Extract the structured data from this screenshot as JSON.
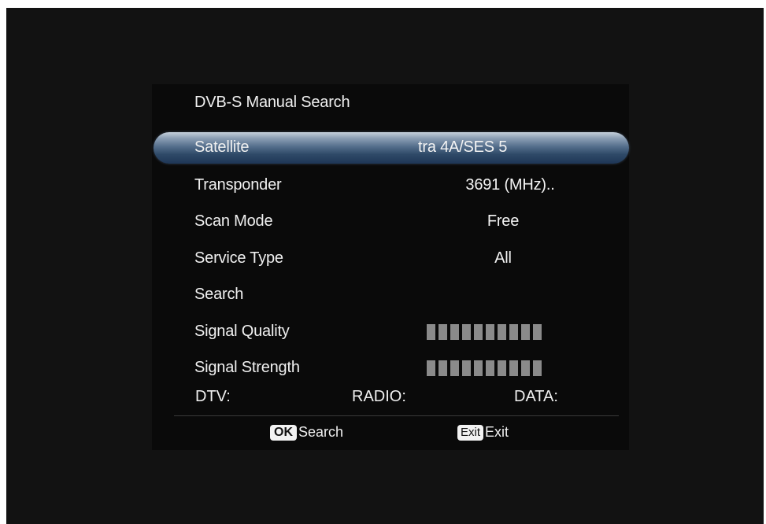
{
  "menu": {
    "title": "DVB-S Manual Search",
    "rows": [
      {
        "label": "Satellite",
        "value": "tra 4A/SES 5"
      },
      {
        "label": "Transponder",
        "value": "3691 (MHz).."
      },
      {
        "label": "Scan Mode",
        "value": "Free"
      },
      {
        "label": "Service Type",
        "value": "All"
      },
      {
        "label": "Search",
        "value": ""
      },
      {
        "label": "Signal Quality",
        "level": 0
      },
      {
        "label": "Signal Strength",
        "level": 0
      }
    ],
    "segments_total": 10
  },
  "counts": {
    "dtv_label": "DTV:",
    "radio_label": "RADIO:",
    "data_label": "DATA:"
  },
  "footer": {
    "ok_key": "OK",
    "ok_label": "Search",
    "exit_key": "Exit",
    "exit_label": "Exit"
  },
  "colors": {
    "highlight": "#56708d",
    "panel": "#0a0a0a",
    "bar_segment_empty": "#8a8a8a"
  }
}
